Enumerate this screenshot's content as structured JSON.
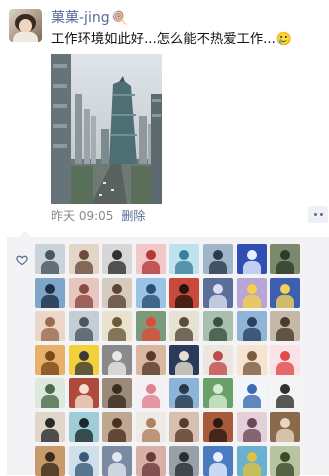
{
  "post": {
    "nickname": "菓菓-jing",
    "nickname_emoji": "🍭",
    "text": "工作环境如此好...怎么能不热爱工作...",
    "text_emoji": "🥲",
    "time": "昨天 09:05",
    "delete_label": "删除"
  },
  "colors": {
    "link": "#576b95",
    "text": "#111111",
    "meta": "#8a8a8a",
    "likes_bg": "#f3f3f5"
  },
  "likes": {
    "icon": "heart-outline-icon",
    "avatars": [
      {
        "bg": "#c9d3da",
        "fg": "#4a5560"
      },
      {
        "bg": "#e3d6c9",
        "fg": "#6b4e3a"
      },
      {
        "bg": "#d7d7d7",
        "fg": "#303030"
      },
      {
        "bg": "#f2c7c7",
        "fg": "#b33a3a"
      },
      {
        "bg": "#bfe2ef",
        "fg": "#3a7f9a"
      },
      {
        "bg": "#9fb5c8",
        "fg": "#2a3a4a"
      },
      {
        "bg": "#2f4fb3",
        "fg": "#e6f0ff"
      },
      {
        "bg": "#7a8a6a",
        "fg": "#2e3a2a"
      },
      {
        "bg": "#7fa6c8",
        "fg": "#1e3046"
      },
      {
        "bg": "#e8c6c0",
        "fg": "#8a4a40"
      },
      {
        "bg": "#d6cbbf",
        "fg": "#5a4536"
      },
      {
        "bg": "#9cc3e6",
        "fg": "#2a4f73"
      },
      {
        "bg": "#c94a3a",
        "fg": "#2a1410"
      },
      {
        "bg": "#5a6e9a",
        "fg": "#d8e0f0"
      },
      {
        "bg": "#b8a6d6",
        "fg": "#f4d04a"
      },
      {
        "bg": "#3d5fb0",
        "fg": "#f2d25a"
      },
      {
        "bg": "#ead7c8",
        "fg": "#9a6a50"
      },
      {
        "bg": "#c4ccd4",
        "fg": "#4a5660"
      },
      {
        "bg": "#e9e2cf",
        "fg": "#6b5a3a"
      },
      {
        "bg": "#7a9a7a",
        "fg": "#e04a3a"
      },
      {
        "bg": "#e6e2d4",
        "fg": "#5a4a3a"
      },
      {
        "bg": "#a9c0b0",
        "fg": "#3a5040"
      },
      {
        "bg": "#8fb4d6",
        "fg": "#2a4060"
      },
      {
        "bg": "#c4b8a8",
        "fg": "#4a3a2a"
      },
      {
        "bg": "#e9b06a",
        "fg": "#7a4a1a"
      },
      {
        "bg": "#f2d13a",
        "fg": "#3a3a3a"
      },
      {
        "bg": "#8a8a8a",
        "fg": "#e8e8e8"
      },
      {
        "bg": "#d8b8a0",
        "fg": "#5a3a2a"
      },
      {
        "bg": "#2a3a5a",
        "fg": "#e8e0d0"
      },
      {
        "bg": "#ece6e0",
        "fg": "#c04a4a"
      },
      {
        "bg": "#f4e4d0",
        "fg": "#7a5a40"
      },
      {
        "bg": "#fbe2e6",
        "fg": "#e24a4a"
      },
      {
        "bg": "#dde9dd",
        "fg": "#4a6a4a"
      },
      {
        "bg": "#b04a3a",
        "fg": "#f4e0d0"
      },
      {
        "bg": "#9a8a7a",
        "fg": "#3a2a20"
      },
      {
        "bg": "#f4f0f2",
        "fg": "#e08090"
      },
      {
        "bg": "#8ab4d8",
        "fg": "#2a3a4a"
      },
      {
        "bg": "#6aa06a",
        "fg": "#d8ecd0"
      },
      {
        "bg": "#f2f6fa",
        "fg": "#3a6ab0"
      },
      {
        "bg": "#f4f4f4",
        "fg": "#303030"
      },
      {
        "bg": "#e2d6ca",
        "fg": "#2a2a2a"
      },
      {
        "bg": "#a0ccd8",
        "fg": "#1a2a2a"
      },
      {
        "bg": "#c0a890",
        "fg": "#4a3020"
      },
      {
        "bg": "#eeeae4",
        "fg": "#b08060"
      },
      {
        "bg": "#d8c0b0",
        "fg": "#5a3a2a"
      },
      {
        "bg": "#a85a3a",
        "fg": "#2a1a10"
      },
      {
        "bg": "#e4d0d8",
        "fg": "#6a4a5a"
      },
      {
        "bg": "#8a6a4a",
        "fg": "#e8d8c0"
      },
      {
        "bg": "#c89a6a",
        "fg": "#3a2a1a"
      },
      {
        "bg": "#cfe0ec",
        "fg": "#3a5a7a"
      },
      {
        "bg": "#7a8aa0",
        "fg": "#e0e8f0"
      },
      {
        "bg": "#d8b0a8",
        "fg": "#6a3a3a"
      },
      {
        "bg": "#9aa0a8",
        "fg": "#2a2e34"
      },
      {
        "bg": "#4a7ac0",
        "fg": "#e8f0ff"
      },
      {
        "bg": "#6ab0d0",
        "fg": "#e0c040"
      },
      {
        "bg": "#b8c4a0",
        "fg": "#3a4a2a"
      }
    ]
  }
}
